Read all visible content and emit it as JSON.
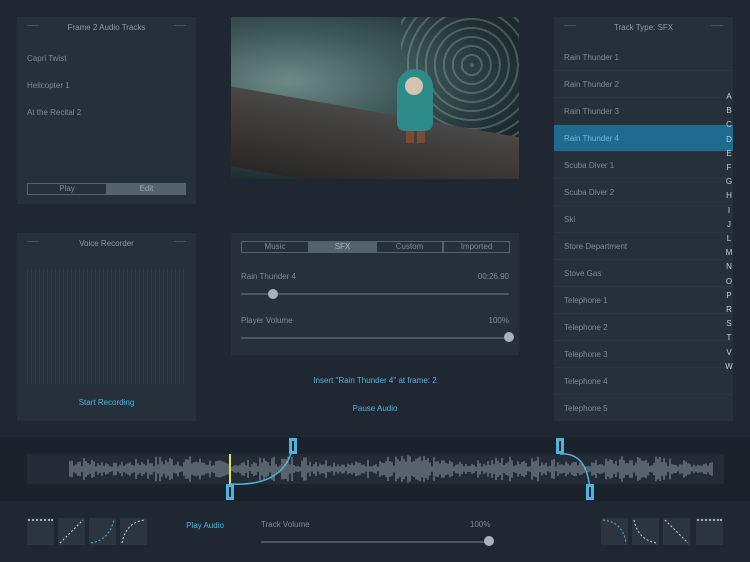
{
  "audio_tracks": {
    "title": "Frame 2 Audio Tracks",
    "items": [
      "Capri Twist",
      "Helicopter 1",
      "At the Recital 2"
    ],
    "play_label": "Play",
    "edit_label": "Edit"
  },
  "voice_recorder": {
    "title": "Voice Recorder",
    "start_label": "Start Recording"
  },
  "player": {
    "tabs": [
      "Music",
      "SFX",
      "Custom",
      "Imported"
    ],
    "selected_tab": "SFX",
    "track_name": "Rain Thunder 4",
    "time": "00:26.90",
    "position_fraction": 0.12,
    "volume_label": "Player Volume",
    "volume_value": "100%",
    "volume_fraction": 1.0
  },
  "actions": {
    "insert_label": "Insert \"Rain Thunder 4\" at frame: 2",
    "pause_label": "Pause Audio"
  },
  "track_list": {
    "title": "Track Type: SFX",
    "items": [
      "Rain Thunder 1",
      "Rain Thunder 2",
      "Rain Thunder 3",
      "Rain Thunder 4",
      "Scuba Diver 1",
      "Scuba Diver 2",
      "Ski",
      "Store Department",
      "Stove Gas",
      "Telephone 1",
      "Telephone 2",
      "Telephone 3",
      "Telephone 4",
      "Telephone 5"
    ],
    "selected": "Rain Thunder 4"
  },
  "alphabet": [
    "A",
    "B",
    "C",
    "D",
    "E",
    "F",
    "G",
    "H",
    "I",
    "J",
    "L",
    "M",
    "N",
    "O",
    "P",
    "R",
    "S",
    "T",
    "V",
    "W"
  ],
  "bottom": {
    "play_audio_label": "Play Audio",
    "track_volume_label": "Track Volume",
    "track_volume_value": "100%",
    "track_volume_fraction": 1.0
  },
  "colors": {
    "accent": "#4fb3dc",
    "selected_row": "#1e6b8f",
    "playhead": "#e8e24a"
  }
}
